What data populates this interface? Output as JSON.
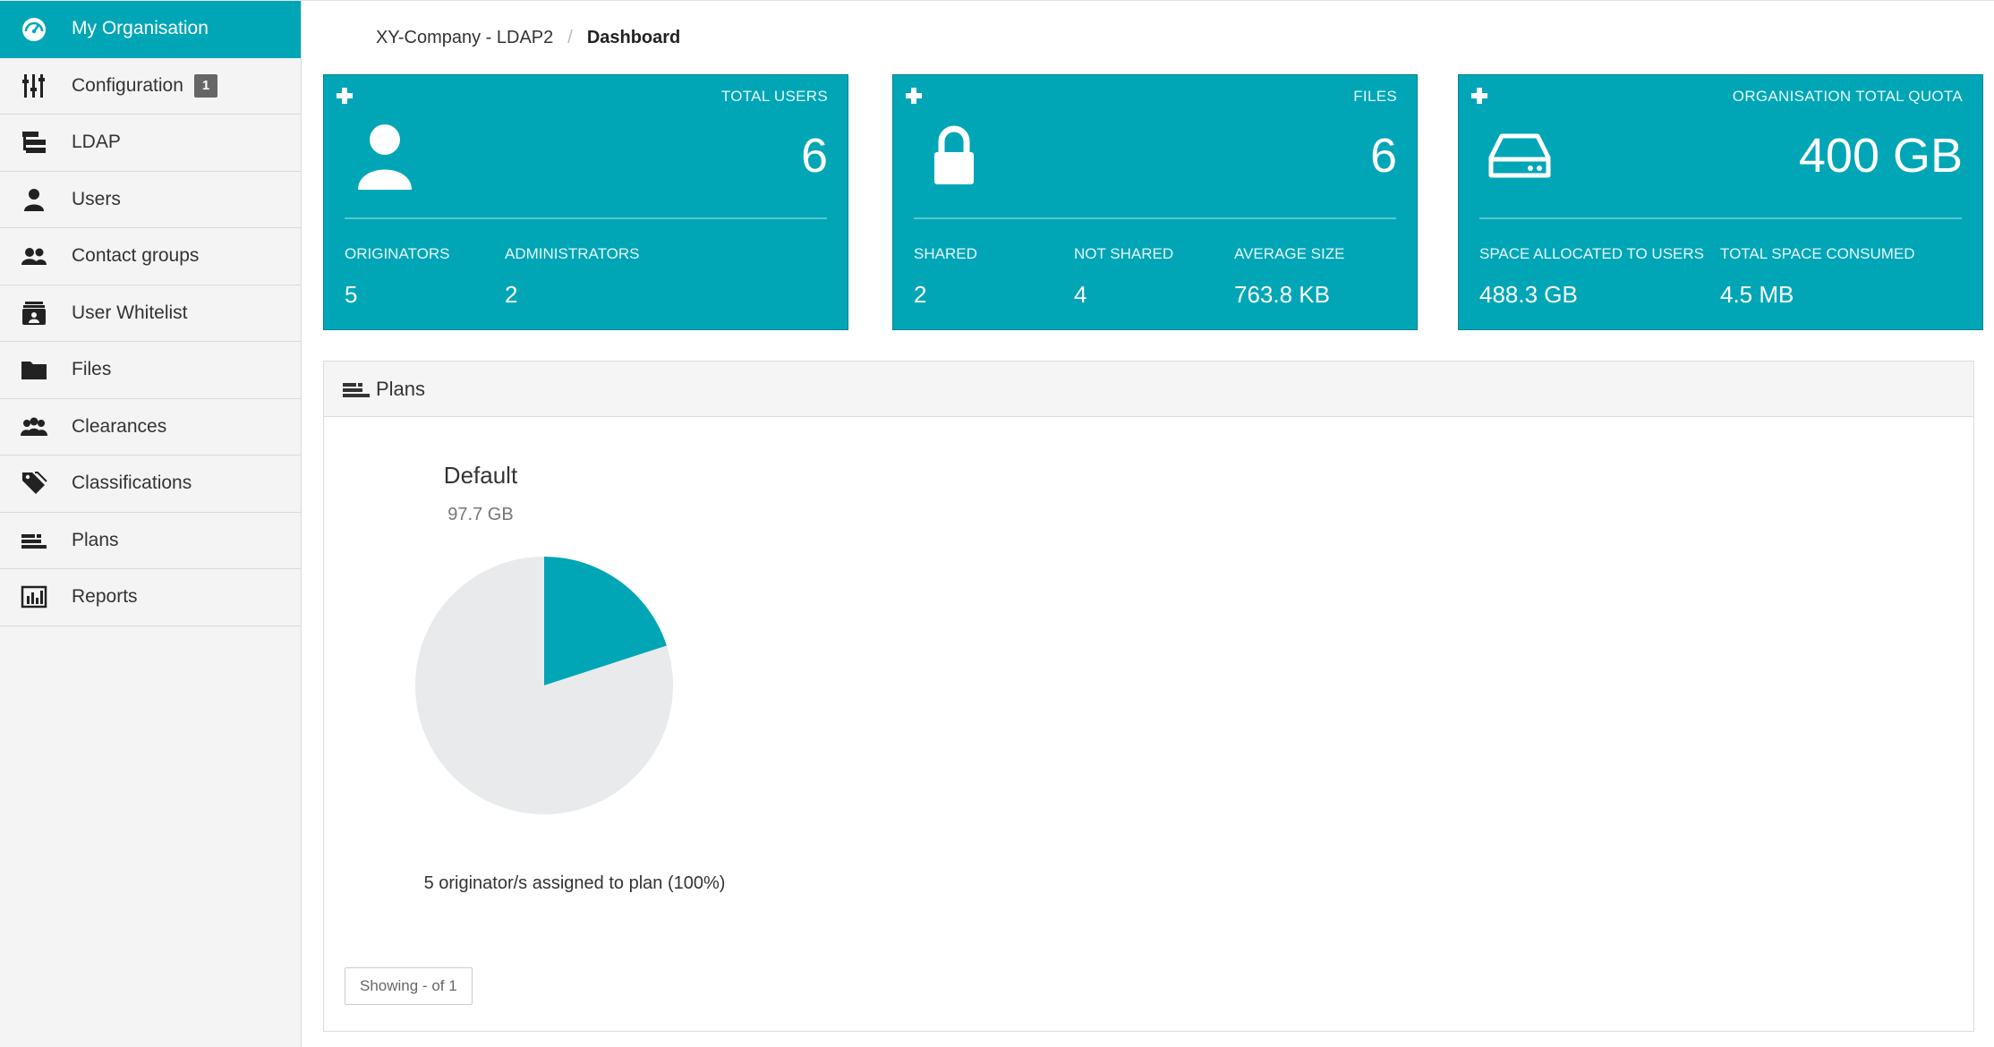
{
  "sidebar": {
    "items": [
      {
        "label": "My Organisation",
        "icon": "dashboard-icon"
      },
      {
        "label": "Configuration",
        "icon": "sliders-icon",
        "badge": "1"
      },
      {
        "label": "LDAP",
        "icon": "ldap-icon"
      },
      {
        "label": "Users",
        "icon": "user-icon"
      },
      {
        "label": "Contact groups",
        "icon": "group-icon"
      },
      {
        "label": "User Whitelist",
        "icon": "whitelist-icon"
      },
      {
        "label": "Files",
        "icon": "folder-icon"
      },
      {
        "label": "Clearances",
        "icon": "clearances-icon"
      },
      {
        "label": "Classifications",
        "icon": "tags-icon"
      },
      {
        "label": "Plans",
        "icon": "plans-icon"
      },
      {
        "label": "Reports",
        "icon": "reports-icon"
      }
    ]
  },
  "breadcrumb": {
    "parent": "XY-Company - LDAP2",
    "separator": "/",
    "current": "Dashboard"
  },
  "cards": {
    "users": {
      "title": "TOTAL USERS",
      "value": "6",
      "sub1_label": "ORIGINATORS",
      "sub1_value": "5",
      "sub2_label": "ADMINISTRATORS",
      "sub2_value": "2"
    },
    "files": {
      "title": "FILES",
      "value": "6",
      "sub1_label": "SHARED",
      "sub1_value": "2",
      "sub2_label": "NOT SHARED",
      "sub2_value": "4",
      "sub3_label": "AVERAGE SIZE",
      "sub3_value": "763.8 KB"
    },
    "quota": {
      "title": "ORGANISATION TOTAL QUOTA",
      "value": "400 GB",
      "sub1_label": "SPACE ALLOCATED TO USERS",
      "sub1_value": "488.3 GB",
      "sub2_label": "TOTAL SPACE CONSUMED",
      "sub2_value": "4.5 MB"
    }
  },
  "plans": {
    "header": "Plans",
    "plan_name": "Default",
    "plan_size": "97.7 GB",
    "note": "5 originator/s assigned to plan (100%)",
    "paging": "Showing - of 1",
    "chart_data": {
      "type": "pie",
      "slices": [
        {
          "value": 20,
          "color": "#00a6b6"
        },
        {
          "value": 80,
          "color": "#e9eaec"
        }
      ]
    }
  },
  "colors": {
    "accent": "#00a6b6",
    "accent_dark": "#00838f",
    "pie_rest": "#e9eaec"
  }
}
